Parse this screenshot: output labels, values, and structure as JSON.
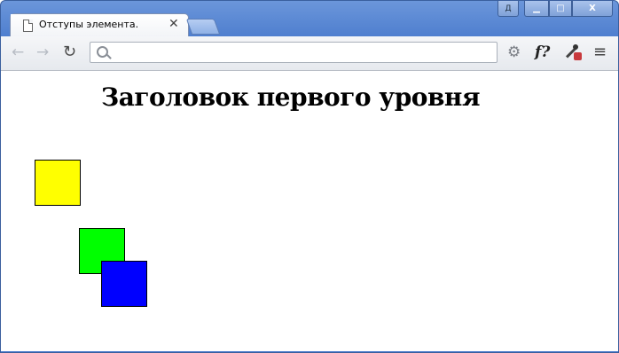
{
  "browser": {
    "tab": {
      "title": "Отступы элемента.",
      "close_glyph": "✕"
    },
    "window_controls": {
      "user_label": "Д",
      "minimize": "▁",
      "maximize": "□",
      "close": "X"
    },
    "toolbar": {
      "back": "←",
      "forward": "→",
      "reload": "↻",
      "address_value": "",
      "gear": "⚙",
      "fx": "f?",
      "menu": "≡"
    }
  },
  "page": {
    "heading": "Заголовок первого уровня",
    "boxes": [
      {
        "name": "yellow-square",
        "color": "#ffff00"
      },
      {
        "name": "green-square",
        "color": "#00ff00"
      },
      {
        "name": "blue-square",
        "color": "#0000ff"
      }
    ]
  }
}
